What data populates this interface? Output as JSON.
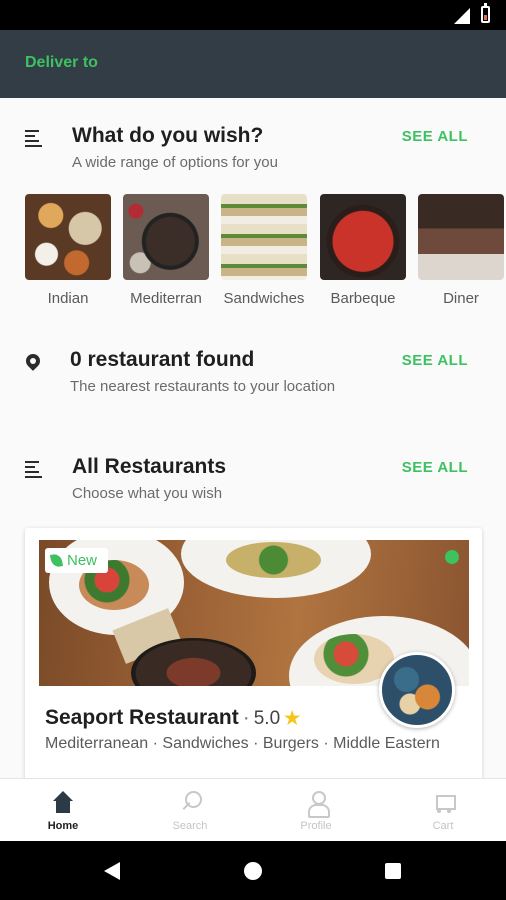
{
  "header": {
    "deliver_label": "Deliver to"
  },
  "sections": {
    "wish": {
      "title": "What do you wish?",
      "subtitle": "A wide range of options for you",
      "see_all": "SEE ALL"
    },
    "found": {
      "title": "0 restaurant found",
      "subtitle": "The nearest restaurants to your location",
      "see_all": "SEE ALL"
    },
    "all": {
      "title": "All Restaurants",
      "subtitle": "Choose what you wish",
      "see_all": "SEE ALL"
    }
  },
  "categories": [
    {
      "label": "Indian",
      "image": "indian-food-image"
    },
    {
      "label": "Mediterran",
      "image": "mediterranean-food-image"
    },
    {
      "label": "Sandwiches",
      "image": "sandwiches-image"
    },
    {
      "label": "Barbeque",
      "image": "barbeque-image"
    },
    {
      "label": "Diner",
      "image": "diner-image"
    }
  ],
  "restaurant": {
    "badge": "New",
    "name": "Seaport Restaurant",
    "separator": "·",
    "rating": "5.0",
    "star": "★",
    "tags": "Mediterranean · Sandwiches · Burgers · Middle Eastern",
    "open_status_color": "#3ec160"
  },
  "bottom_nav": [
    {
      "label": "Home",
      "icon": "home-icon",
      "active": true
    },
    {
      "label": "Search",
      "icon": "search-icon",
      "active": false
    },
    {
      "label": "Profile",
      "icon": "profile-icon",
      "active": false
    },
    {
      "label": "Cart",
      "icon": "cart-icon",
      "active": false
    }
  ],
  "colors": {
    "accent": "#3ec160",
    "header_bg": "#323d46"
  }
}
